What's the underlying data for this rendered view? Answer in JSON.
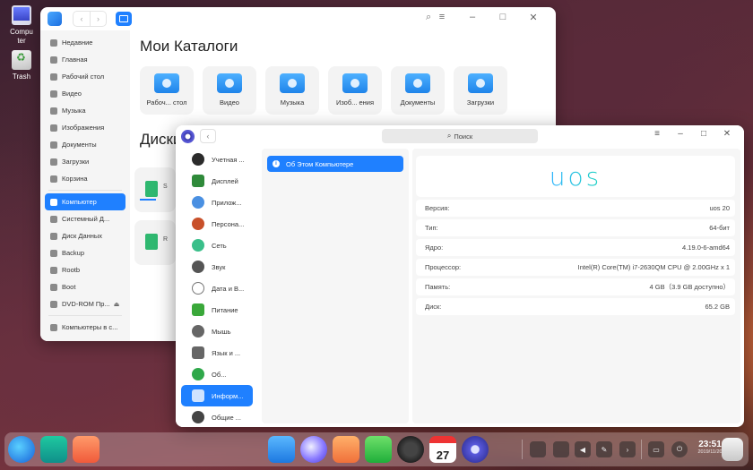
{
  "desktop": {
    "icons": [
      {
        "label_line1": "Compu",
        "label_line2": "ter"
      },
      {
        "label": "Trash"
      }
    ]
  },
  "file_manager": {
    "title_icons": {
      "search": "search-icon",
      "menu": "≡",
      "minimize": "–",
      "maximize": "□",
      "close": "✕"
    },
    "sidebar": [
      {
        "label": "Недавние",
        "icon": "clock-icon"
      },
      {
        "label": "Главная",
        "icon": "home-icon"
      },
      {
        "label": "Рабочий стол",
        "icon": "desktop-icon"
      },
      {
        "label": "Видео",
        "icon": "video-icon"
      },
      {
        "label": "Музыка",
        "icon": "music-icon"
      },
      {
        "label": "Изображения",
        "icon": "image-icon"
      },
      {
        "label": "Документы",
        "icon": "document-icon"
      },
      {
        "label": "Загрузки",
        "icon": "download-icon"
      },
      {
        "label": "Корзина",
        "icon": "trash-icon"
      },
      {
        "label": "Компьютер",
        "icon": "computer-icon",
        "active": true
      },
      {
        "label": "Системный Д...",
        "icon": "disk-icon"
      },
      {
        "label": "Диск Данных",
        "icon": "disk-icon"
      },
      {
        "label": "Backup",
        "icon": "disk-icon"
      },
      {
        "label": "Rootb",
        "icon": "disk-icon"
      },
      {
        "label": "Boot",
        "icon": "disk-icon"
      },
      {
        "label": "DVD-ROM Пр...",
        "icon": "dvd-icon"
      },
      {
        "label": "Компьютеры в с...",
        "icon": "network-icon"
      }
    ],
    "heading_dirs": "Мои Каталоги",
    "folders": [
      {
        "label": "Рабоч... стол"
      },
      {
        "label": "Видео"
      },
      {
        "label": "Музыка"
      },
      {
        "label": "Изоб... ения"
      },
      {
        "label": "Документы"
      },
      {
        "label": "Загрузки"
      }
    ],
    "heading_disks": "Диски",
    "disks": [
      {
        "label": "S"
      },
      {
        "label": "R"
      }
    ]
  },
  "control_center": {
    "search_placeholder": "Поиск",
    "sidebar": [
      {
        "label": "Учетная ...",
        "icon": "account-icon",
        "color": "#2b2b2b"
      },
      {
        "label": "Дисплей",
        "icon": "display-icon",
        "color": "#2f8a3a"
      },
      {
        "label": "Прилож...",
        "icon": "apps-icon",
        "color": "#4a90e2"
      },
      {
        "label": "Персона...",
        "icon": "personalization-icon",
        "color": "#c8502a"
      },
      {
        "label": "Сеть",
        "icon": "network-icon",
        "color": "#3abf8a"
      },
      {
        "label": "Звук",
        "icon": "sound-icon",
        "color": "#555555"
      },
      {
        "label": "Дата и В...",
        "icon": "clock-icon",
        "color": "#777777"
      },
      {
        "label": "Питание",
        "icon": "power-icon",
        "color": "#3aa83a"
      },
      {
        "label": "Мышь",
        "icon": "mouse-icon",
        "color": "#666666"
      },
      {
        "label": "Язык и ...",
        "icon": "keyboard-icon",
        "color": "#666666"
      },
      {
        "label": "Об...",
        "icon": "update-icon",
        "color": "#2fa84a"
      },
      {
        "label": "Информ...",
        "icon": "info-icon",
        "color": "#2f7ad8",
        "active": true
      },
      {
        "label": "Общие ...",
        "icon": "general-icon",
        "color": "#444444"
      }
    ],
    "submenu": {
      "label": "Об Этом Компьютере"
    },
    "logo_text": "uos",
    "info": [
      {
        "key": "Версия:",
        "value": "uos 20"
      },
      {
        "key": "Тип:",
        "value": "64-бит"
      },
      {
        "key": "Ядро:",
        "value": "4.19.0-6-amd64"
      },
      {
        "key": "Процессор:",
        "value": "Intel(R) Core(TM) i7-2630QM CPU @ 2.00GHz x 1"
      },
      {
        "key": "Память:",
        "value": "4 GB（3.9 GB доступно）"
      },
      {
        "key": "Диск:",
        "value": "65.2 GB"
      }
    ]
  },
  "dock": {
    "calendar_day": "27",
    "clock_time": "23:51",
    "clock_date": "2019/11/20"
  }
}
